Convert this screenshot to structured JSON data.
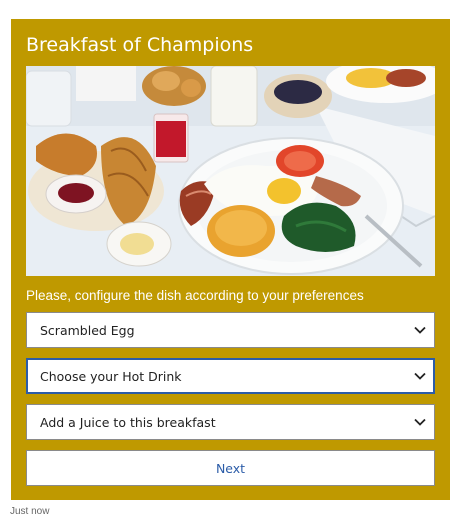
{
  "card": {
    "title": "Breakfast of Champions",
    "prompt": "Please, configure the dish according to your preferences",
    "background_color": "#bf9900"
  },
  "hero_image": {
    "description_icon": "breakfast-plate-photo"
  },
  "selects": {
    "egg": {
      "value": "Scrambled Egg"
    },
    "hot_drink": {
      "value": "Choose your Hot Drink"
    },
    "juice": {
      "value": "Add a Juice to this breakfast"
    }
  },
  "next_button": {
    "label": "Next",
    "color": "#2b5ca8"
  },
  "timestamp": "Just now"
}
